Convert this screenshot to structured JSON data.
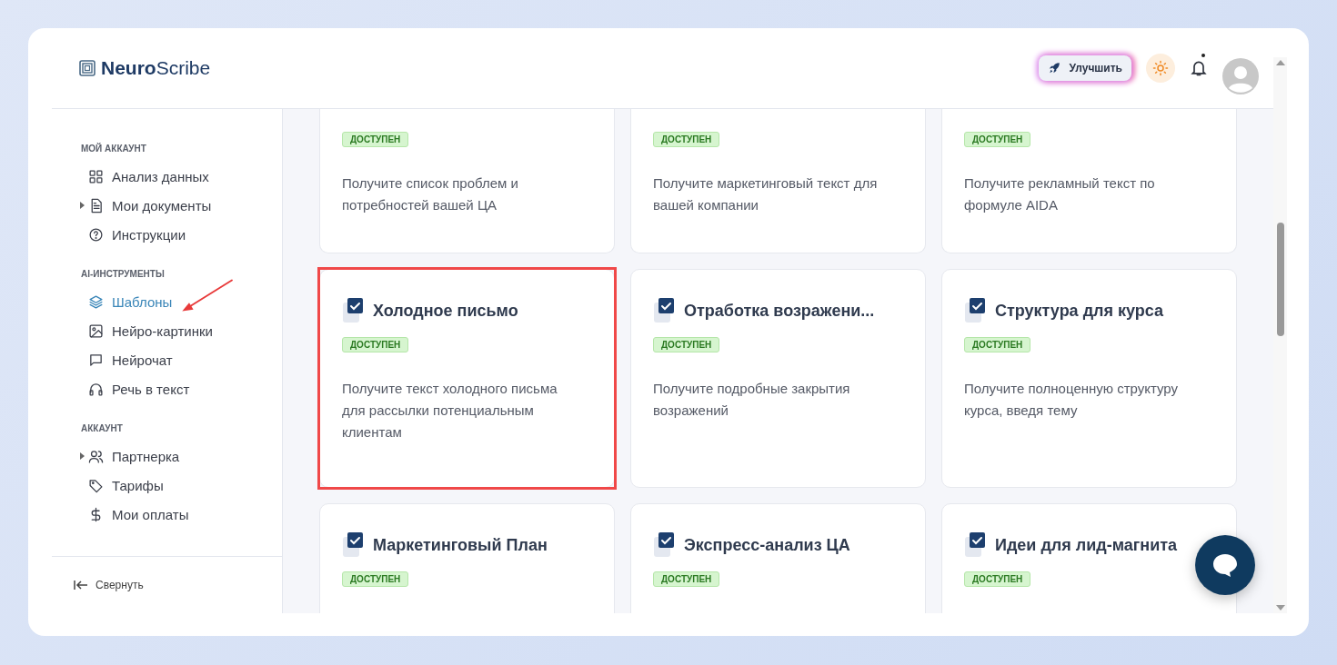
{
  "logo": {
    "strong": "Neuro",
    "light": "Scribe"
  },
  "header": {
    "upgrade_button": "Улучшить"
  },
  "sidebar": {
    "sections": [
      {
        "title": "МОЙ АККАУНТ",
        "items": [
          {
            "label": "Анализ данных",
            "expandable": false,
            "selected": false
          },
          {
            "label": "Мои документы",
            "expandable": true,
            "selected": false
          },
          {
            "label": "Инструкции",
            "expandable": false,
            "selected": false
          }
        ]
      },
      {
        "title": "AI-ИНСТРУМЕНТЫ",
        "items": [
          {
            "label": "Шаблоны",
            "expandable": false,
            "selected": true
          },
          {
            "label": "Нейро-картинки",
            "expandable": false,
            "selected": false
          },
          {
            "label": "Нейрочат",
            "expandable": false,
            "selected": false
          },
          {
            "label": "Речь в текст",
            "expandable": false,
            "selected": false
          }
        ]
      },
      {
        "title": "АККАУНТ",
        "items": [
          {
            "label": "Партнерка",
            "expandable": true,
            "selected": false
          },
          {
            "label": "Тарифы",
            "expandable": false,
            "selected": false
          },
          {
            "label": "Мои оплаты",
            "expandable": false,
            "selected": false
          }
        ]
      }
    ],
    "collapse": "Свернуть"
  },
  "cards": [
    {
      "badge": "ДОСТУПЕН",
      "description": "Получите список проблем и потребностей вашей ЦА",
      "highlighted": false
    },
    {
      "badge": "ДОСТУПЕН",
      "description": "Получите маркетинговый текст для вашей компании",
      "highlighted": false
    },
    {
      "badge": "ДОСТУПЕН",
      "description": "Получите рекламный текст по формуле AIDA",
      "highlighted": false
    },
    {
      "title": "Холодное письмо",
      "badge": "ДОСТУПЕН",
      "description": "Получите текст холодного письма для рассылки потенциальным клиентам",
      "highlighted": true
    },
    {
      "title": "Отработка возражени...",
      "badge": "ДОСТУПЕН",
      "description": "Получите подробные закрытия возражений",
      "highlighted": false
    },
    {
      "title": "Структура для курса",
      "badge": "ДОСТУПЕН",
      "description": "Получите полноценную структуру курса, введя тему",
      "highlighted": false
    },
    {
      "title": "Маркетинговый План",
      "badge": "ДОСТУПЕН",
      "highlighted": false
    },
    {
      "title": "Экспресс-анализ ЦА",
      "badge": "ДОСТУПЕН",
      "highlighted": false
    },
    {
      "title": "Идеи для лид-магнита",
      "badge": "ДОСТУПЕН",
      "highlighted": false
    }
  ]
}
